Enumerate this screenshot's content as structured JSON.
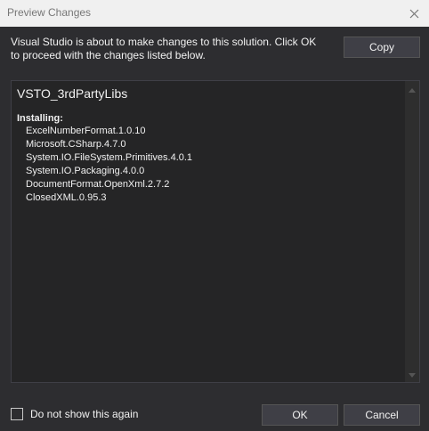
{
  "window": {
    "title": "Preview Changes",
    "close_icon": "close-icon"
  },
  "message": "Visual Studio is about to make changes to this solution. Click OK to proceed with the changes listed below.",
  "buttons": {
    "copy": "Copy",
    "ok": "OK",
    "cancel": "Cancel"
  },
  "changes": {
    "project": "VSTO_3rdPartyLibs",
    "section": "Installing:",
    "packages": [
      "ExcelNumberFormat.1.0.10",
      "Microsoft.CSharp.4.7.0",
      "System.IO.FileSystem.Primitives.4.0.1",
      "System.IO.Packaging.4.0.0",
      "DocumentFormat.OpenXml.2.7.2",
      "ClosedXML.0.95.3"
    ]
  },
  "checkbox": {
    "label": "Do not show this again",
    "checked": false
  },
  "colors": {
    "background": "#2d2d30",
    "titlebar": "#f0f0f0",
    "button": "#3f3f46",
    "list_background": "#252526",
    "text": "#f1f1f1"
  }
}
